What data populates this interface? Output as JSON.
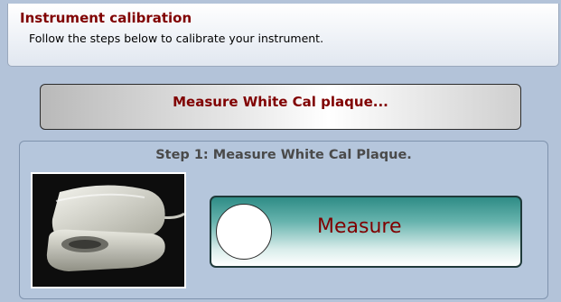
{
  "header": {
    "title": "Instrument calibration",
    "subtitle": "Follow the steps below to calibrate your instrument."
  },
  "status": {
    "text": "Measure White Cal plaque..."
  },
  "step": {
    "title": "Step 1: Measure White Cal Plaque.",
    "image": "white-cal-plaque-photo",
    "measure_label": "Measure"
  },
  "colors": {
    "background": "#b3c3d9",
    "title_text": "#800000",
    "button_teal": "#2f8c86"
  }
}
